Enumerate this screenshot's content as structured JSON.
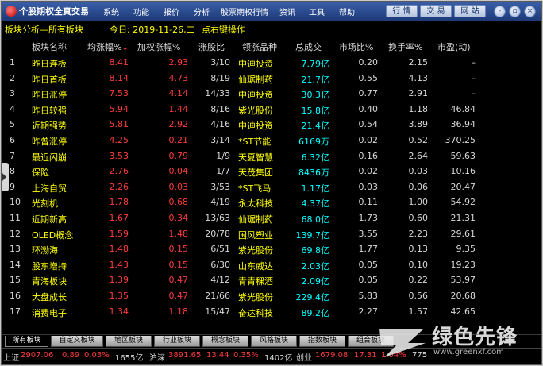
{
  "app": {
    "title": "个股期权全真交易"
  },
  "menu": [
    "系统",
    "功能",
    "报价",
    "分析",
    "股票期权行情",
    "资讯",
    "工具",
    "帮助"
  ],
  "top_buttons": [
    "行 情",
    "交 易",
    "网 站"
  ],
  "window_controls": {
    "minimize": "-",
    "restore": "▫",
    "close": "×"
  },
  "infobar": {
    "title": "板块分析—所有板块",
    "date": "今日: 2019-11-26,二",
    "hint": "点右键操作"
  },
  "columns": [
    "板块名称",
    "均涨幅%",
    "加权涨幅%",
    "涨股比",
    "领涨品种",
    "总成交",
    "市场比%",
    "换手率%",
    "市盈(动)"
  ],
  "sort_mark": "↓",
  "colors": {
    "up": "#ff3c3c",
    "down": "#00e000",
    "name": "#ffff00",
    "volume": "#00ffff",
    "neutral": "#d8d8d8",
    "accent": "#1d3a78"
  },
  "rows": [
    {
      "idx": "1",
      "name": "昨日连板",
      "avg": "8.41",
      "wavg": "2.93",
      "ratio": "3/10",
      "lead": "中迪投资",
      "vol": "7.79亿",
      "mkt": "0.20",
      "turn": "2.15",
      "pe": "–"
    },
    {
      "idx": "2",
      "name": "昨日首板",
      "avg": "8.14",
      "wavg": "4.73",
      "ratio": "8/19",
      "lead": "仙琚制药",
      "vol": "21.7亿",
      "mkt": "0.55",
      "turn": "4.13",
      "pe": "–"
    },
    {
      "idx": "3",
      "name": "昨日涨停",
      "avg": "7.53",
      "wavg": "4.14",
      "ratio": "14/33",
      "lead": "中迪投资",
      "vol": "30.3亿",
      "mkt": "0.77",
      "turn": "2.91",
      "pe": "–"
    },
    {
      "idx": "4",
      "name": "昨日较强",
      "avg": "5.94",
      "wavg": "1.44",
      "ratio": "8/16",
      "lead": "紫光股份",
      "vol": "15.8亿",
      "mkt": "0.40",
      "turn": "1.18",
      "pe": "46.84"
    },
    {
      "idx": "5",
      "name": "近期强势",
      "avg": "5.81",
      "wavg": "2.92",
      "ratio": "4/16",
      "lead": "中迪投资",
      "vol": "21.4亿",
      "mkt": "0.54",
      "turn": "3.89",
      "pe": "36.94"
    },
    {
      "idx": "6",
      "name": "昨曾涨停",
      "avg": "4.25",
      "wavg": "0.21",
      "ratio": "3/14",
      "lead": "*ST节能",
      "vol": "6169万",
      "mkt": "0.02",
      "turn": "0.52",
      "pe": "370.25"
    },
    {
      "idx": "7",
      "name": "最近闪崩",
      "avg": "3.53",
      "wavg": "0.79",
      "ratio": "1/9",
      "lead": "天夏智慧",
      "vol": "6.32亿",
      "mkt": "0.16",
      "turn": "2.64",
      "pe": "59.63"
    },
    {
      "idx": "8",
      "name": "保险",
      "avg": "2.76",
      "wavg": "0.04",
      "ratio": "1/7",
      "lead": "天茂集团",
      "vol": "8436万",
      "mkt": "0.02",
      "turn": "0.03",
      "pe": "10.16"
    },
    {
      "idx": "9",
      "name": "上海自贸",
      "avg": "2.26",
      "wavg": "0.03",
      "ratio": "3/53",
      "lead": "*ST飞马",
      "vol": "1.17亿",
      "mkt": "0.03",
      "turn": "0.06",
      "pe": "20.47"
    },
    {
      "idx": "10",
      "name": "光刻机",
      "avg": "1.78",
      "wavg": "0.68",
      "ratio": "4/19",
      "lead": "永太科技",
      "vol": "4.37亿",
      "mkt": "0.11",
      "turn": "1.00",
      "pe": "54.92"
    },
    {
      "idx": "11",
      "name": "近期新高",
      "avg": "1.67",
      "wavg": "0.34",
      "ratio": "13/63",
      "lead": "仙琚制药",
      "vol": "68.0亿",
      "mkt": "1.73",
      "turn": "0.60",
      "pe": "21.31"
    },
    {
      "idx": "12",
      "name": "OLED概念",
      "avg": "1.59",
      "wavg": "1.48",
      "ratio": "20/78",
      "lead": "国风塑业",
      "vol": "139.7亿",
      "mkt": "3.55",
      "turn": "2.23",
      "pe": "29.61"
    },
    {
      "idx": "13",
      "name": "环渤海",
      "avg": "1.48",
      "wavg": "0.15",
      "ratio": "6/51",
      "lead": "紫光股份",
      "vol": "69.8亿",
      "mkt": "1.77",
      "turn": "0.13",
      "pe": "9.35"
    },
    {
      "idx": "14",
      "name": "股东增持",
      "avg": "1.43",
      "wavg": "0.15",
      "ratio": "6/30",
      "lead": "山东威达",
      "vol": "2.03亿",
      "mkt": "0.05",
      "turn": "0.10",
      "pe": "19.23"
    },
    {
      "idx": "15",
      "name": "青海板块",
      "avg": "1.39",
      "wavg": "0.47",
      "ratio": "4/12",
      "lead": "青青稞酒",
      "vol": "2.09亿",
      "mkt": "0.05",
      "turn": "0.22",
      "pe": "53.97"
    },
    {
      "idx": "16",
      "name": "大盘成长",
      "avg": "1.35",
      "wavg": "0.47",
      "ratio": "21/66",
      "lead": "紫光股份",
      "vol": "229.4亿",
      "mkt": "5.83",
      "turn": "0.56",
      "pe": "20.68"
    },
    {
      "idx": "17",
      "name": "消费电子",
      "avg": "1.34",
      "wavg": "1.18",
      "ratio": "15/47",
      "lead": "奋达科技",
      "vol": "89.2亿",
      "mkt": "2.27",
      "turn": "1.57",
      "pe": "42.65"
    }
  ],
  "tabs": [
    "所有板块",
    "自定义板块",
    "地区板块",
    "行业板块",
    "概念板块",
    "风格板块",
    "指数板块",
    "组合板块"
  ],
  "status": {
    "sh_label": "上证",
    "sh_value": "2907.06",
    "sh_chg": "0.89",
    "sh_pct": "0.03%",
    "sh_amount": "1655亿",
    "sz_label": "沪深",
    "sz_value": "3891.65",
    "sz_chg": "13.44",
    "sz_pct": "0.35%",
    "sz_amount": "1402亿",
    "cy_label": "创业",
    "cy_value": "1679.08",
    "cy_chg": "17.31",
    "cy_pct": "1.04%",
    "cy_amount": "775"
  },
  "watermark": {
    "text": "绿色先锋",
    "url": "www.greenxf.com"
  }
}
